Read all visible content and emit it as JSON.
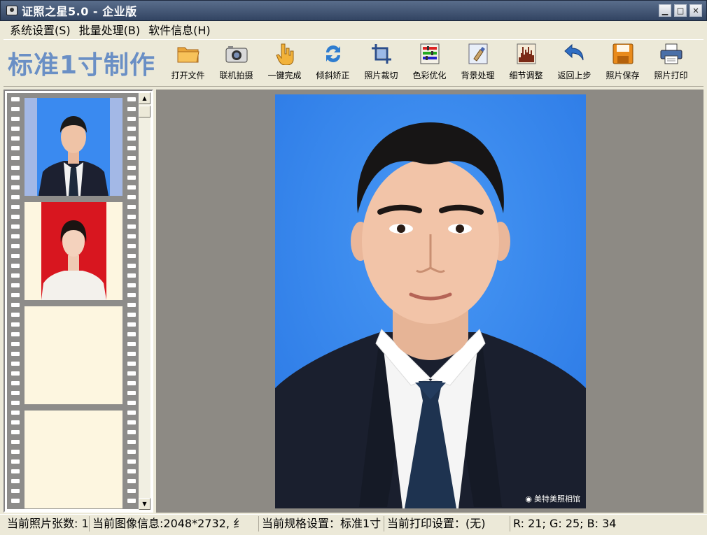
{
  "window": {
    "title": "证照之星5.0 - 企业版",
    "buttons": {
      "minimize": "▁",
      "maximize": "□",
      "close": "✕"
    }
  },
  "menu": [
    {
      "label": "系统设置(S)"
    },
    {
      "label": "批量处理(B)"
    },
    {
      "label": "软件信息(H)"
    }
  ],
  "toolbar": {
    "brand": "标准1寸制作",
    "tools": [
      {
        "label": "打开文件",
        "icon": "folder-icon"
      },
      {
        "label": "联机拍摄",
        "icon": "camera-icon"
      },
      {
        "label": "一键完成",
        "icon": "hand-icon"
      },
      {
        "label": "倾斜矫正",
        "icon": "rotate-icon"
      },
      {
        "label": "照片裁切",
        "icon": "crop-icon"
      },
      {
        "label": "色彩优化",
        "icon": "color-icon"
      },
      {
        "label": "背景处理",
        "icon": "brush-icon"
      },
      {
        "label": "细节调整",
        "icon": "histogram-icon"
      },
      {
        "label": "返回上步",
        "icon": "undo-icon"
      },
      {
        "label": "照片保存",
        "icon": "save-icon"
      },
      {
        "label": "照片打印",
        "icon": "printer-icon"
      }
    ]
  },
  "photo": {
    "watermark": "美特美照相馆"
  },
  "status": {
    "count": "当前照片张数: 1",
    "image_info": "当前图像信息:2048*2732, 纟",
    "spec": "当前规格设置：标准1寸",
    "print": "当前打印设置：(无)",
    "rgb": "R:  21; G:  25; B:  34"
  },
  "colors": {
    "photo_bg": "#3a8af0",
    "thumb_red": "#d8161f",
    "brand": "#6a8fc5"
  }
}
